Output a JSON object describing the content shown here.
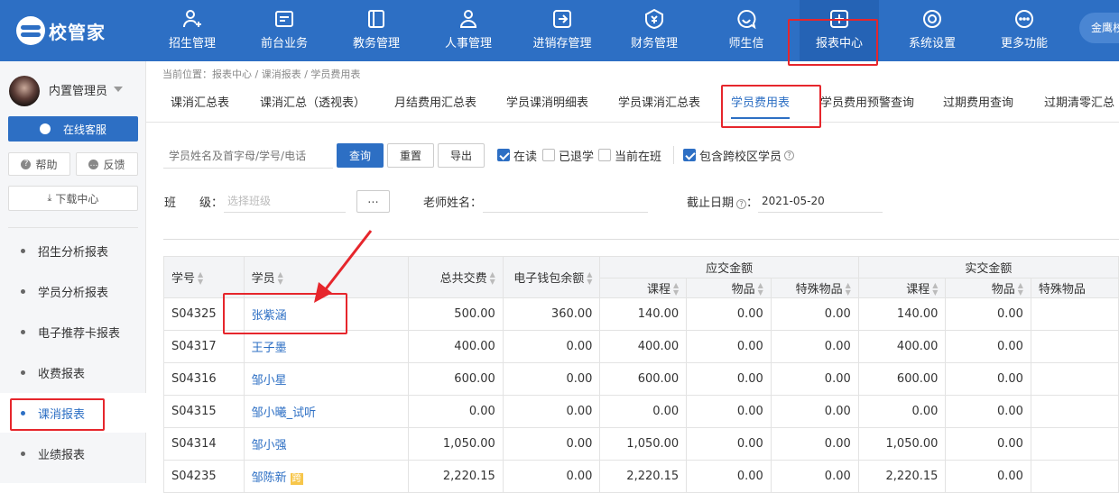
{
  "app": {
    "logo_text": "校管家",
    "user_pill": "金鹰校"
  },
  "nav": [
    {
      "label": "招生管理",
      "icon": "user-plus-icon"
    },
    {
      "label": "前台业务",
      "icon": "desk-icon"
    },
    {
      "label": "教务管理",
      "icon": "book-icon"
    },
    {
      "label": "人事管理",
      "icon": "person-icon"
    },
    {
      "label": "进销存管理",
      "icon": "inventory-icon"
    },
    {
      "label": "财务管理",
      "icon": "finance-icon"
    },
    {
      "label": "师生信",
      "icon": "message-icon"
    },
    {
      "label": "报表中心",
      "icon": "report-icon",
      "active": true
    },
    {
      "label": "系统设置",
      "icon": "settings-icon"
    },
    {
      "label": "更多功能",
      "icon": "more-icon"
    }
  ],
  "sidebar": {
    "admin_name": "内置管理员",
    "service_button": "在线客服",
    "help_button": "帮助",
    "feedback_button": "反馈",
    "download_button": "下载中心",
    "items": [
      {
        "label": "招生分析报表"
      },
      {
        "label": "学员分析报表"
      },
      {
        "label": "电子推荐卡报表"
      },
      {
        "label": "收费报表"
      },
      {
        "label": "课消报表",
        "active": true
      },
      {
        "label": "业绩报表"
      }
    ]
  },
  "breadcrumb": "当前位置：报表中心 / 课消报表 / 学员费用表",
  "tabs": [
    {
      "label": "课消汇总表"
    },
    {
      "label": "课消汇总（透视表）"
    },
    {
      "label": "月结费用汇总表"
    },
    {
      "label": "学员课消明细表"
    },
    {
      "label": "学员课消汇总表"
    },
    {
      "label": "学员费用表",
      "active": true
    },
    {
      "label": "学员费用预警查询"
    },
    {
      "label": "过期费用查询"
    },
    {
      "label": "过期清零汇总"
    }
  ],
  "filters": {
    "search_placeholder": "学员姓名及首字母/学号/电话",
    "query_button": "查询",
    "reset_button": "重置",
    "export_button": "导出",
    "chk_active": "在读",
    "chk_withdrawn": "已退学",
    "chk_in_class": "当前在班",
    "chk_cross_campus": "包含跨校区学员",
    "class_label": "班　　级：",
    "class_placeholder": "选择班级",
    "dots_button": "...",
    "teacher_label": "老师姓名：",
    "date_label": "截止日期",
    "date_colon": "：",
    "date_value": "2021-05-20"
  },
  "table": {
    "headers": {
      "id": "学号",
      "student": "学员",
      "total_paid": "总共交费",
      "wallet_balance": "电子钱包余额",
      "due_group": "应交金额",
      "paid_group": "实交金额",
      "course": "课程",
      "goods": "物品",
      "special_goods": "特殊物品"
    },
    "rows": [
      {
        "id": "S04325",
        "name": "张紫涵",
        "total": "500.00",
        "wallet": "360.00",
        "due_course": "140.00",
        "due_goods": "0.00",
        "due_special": "0.00",
        "paid_course": "140.00",
        "paid_goods": "0.00",
        "paid_special": ""
      },
      {
        "id": "S04317",
        "name": "王子墨",
        "total": "400.00",
        "wallet": "0.00",
        "due_course": "400.00",
        "due_goods": "0.00",
        "due_special": "0.00",
        "paid_course": "400.00",
        "paid_goods": "0.00",
        "paid_special": ""
      },
      {
        "id": "S04316",
        "name": "邹小星",
        "total": "600.00",
        "wallet": "0.00",
        "due_course": "600.00",
        "due_goods": "0.00",
        "due_special": "0.00",
        "paid_course": "600.00",
        "paid_goods": "0.00",
        "paid_special": ""
      },
      {
        "id": "S04315",
        "name": "邹小曦_试听",
        "total": "0.00",
        "wallet": "0.00",
        "due_course": "0.00",
        "due_goods": "0.00",
        "due_special": "0.00",
        "paid_course": "0.00",
        "paid_goods": "0.00",
        "paid_special": ""
      },
      {
        "id": "S04314",
        "name": "邹小强",
        "total": "1,050.00",
        "wallet": "0.00",
        "due_course": "1,050.00",
        "due_goods": "0.00",
        "due_special": "0.00",
        "paid_course": "1,050.00",
        "paid_goods": "0.00",
        "paid_special": ""
      },
      {
        "id": "S04235",
        "name": "邹陈新",
        "tag": "跨",
        "total": "2,220.15",
        "wallet": "0.00",
        "due_course": "2,220.15",
        "due_goods": "0.00",
        "due_special": "0.00",
        "paid_course": "2,220.15",
        "paid_goods": "0.00",
        "paid_special": ""
      }
    ]
  },
  "colors": {
    "brand": "#2d6fc4",
    "annotation": "#e6262c"
  }
}
